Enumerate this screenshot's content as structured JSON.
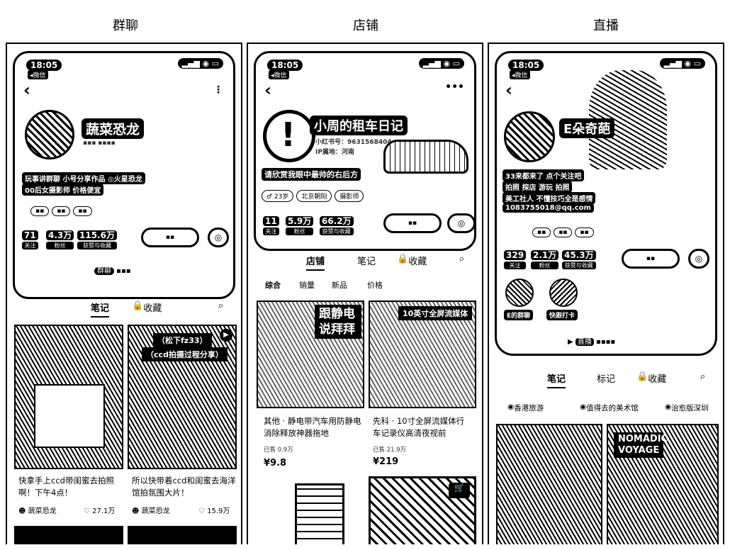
{
  "columns": {
    "group": "群聊",
    "shop": "店铺",
    "live": "直播"
  },
  "status": {
    "time": "18:05",
    "wechat": "◂微信"
  },
  "group_panel": {
    "name": "蔬菜恐龙",
    "tag1": "玩事讲群聊  小号分享作品 ◎火星恐龙",
    "tag2": "00后女摄影师  价格便宜",
    "stats": [
      {
        "num": "71",
        "label": "关注"
      },
      {
        "num": "4.3万",
        "label": "粉丝"
      },
      {
        "num": "115.6万",
        "label": "获赞与收藏"
      }
    ],
    "group_entry": "群聊",
    "tabs": {
      "notes": "笔记",
      "collect": "收藏"
    },
    "posts": [
      {
        "overlay": "（松下fz33）",
        "overlay2": "（ccd拍摄过程分享）",
        "caption": "快拿手上ccd带闺蜜去拍照啊！下午4点！",
        "author": "蔬菜恐龙",
        "likes": "27.1万"
      },
      {
        "caption": "所以快带着ccd和闺蜜去海洋馆拍氛围大片！",
        "author": "蔬菜恐龙",
        "likes": "15.9万"
      }
    ]
  },
  "shop_panel": {
    "name": "小周的租车日记",
    "account": "小红书号：9631568404",
    "location": "IP属地：河南",
    "slogan": "请欣赏我眼中最帅的右后方",
    "chips": [
      "♂ 23岁",
      "北京朝阳",
      "摄影师"
    ],
    "stats": [
      {
        "num": "11",
        "label": "关注"
      },
      {
        "num": "5.9万",
        "label": "粉丝"
      },
      {
        "num": "66.2万",
        "label": "获赞与收藏"
      }
    ],
    "tabs": {
      "shop": "店铺",
      "notes": "笔记",
      "collect": "收藏"
    },
    "filters": [
      "综合",
      "销量",
      "新品",
      "价格"
    ],
    "products": [
      {
        "banner": "跟静电说拜拜",
        "caption": "其他 · 静电带汽车用防静电消除释放神器拖地",
        "sold": "已售 0.9万",
        "price": "¥9.8"
      },
      {
        "banner": "10英寸全屏流媒体",
        "caption": "先科 · 10寸全屏流媒体行车记录仪高清夜视前",
        "sold": "已售 21.9万",
        "price": "¥219"
      }
    ]
  },
  "live_panel": {
    "name": "E朵奇葩",
    "bio1": "33来都来了 点个关注吧",
    "bio2": "拍照  探店  游玩  拍照",
    "bio3": "美工社人 不懂技巧全是感情",
    "email": "1083755018@qq.com",
    "stats": [
      {
        "num": "329",
        "label": "关注"
      },
      {
        "num": "2.1万",
        "label": "粉丝"
      },
      {
        "num": "45.3万",
        "label": "获赞与收藏"
      }
    ],
    "circles": [
      "E的群聊",
      "快跟打卡"
    ],
    "live_entry": "直播",
    "tabs": {
      "notes": "笔记",
      "board": "标记",
      "collect": "收藏"
    },
    "collections": [
      "香港旅游",
      "值得去的美术馆",
      "治愈版深圳"
    ],
    "posts": [
      {
        "overlay": "NOMADIC VOYAGE"
      }
    ]
  }
}
